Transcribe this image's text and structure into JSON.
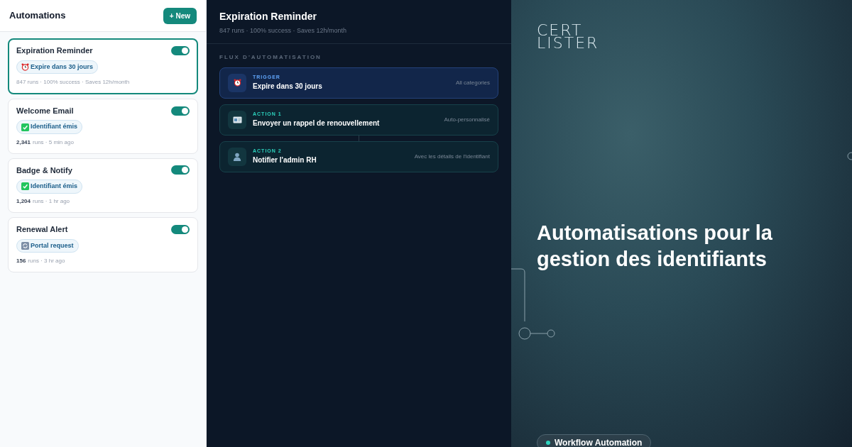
{
  "sidebar": {
    "title": "Automations",
    "new_button": "+ New",
    "items": [
      {
        "name": "Expiration Reminder",
        "on": true,
        "selected": true,
        "badge": {
          "kind": "clock",
          "label": "Expire dans 30 jours"
        },
        "count": "847 runs · 100% success · Saves 12h/month"
      },
      {
        "name": "Welcome Email",
        "on": true,
        "selected": false,
        "badge": {
          "kind": "check",
          "label": "Identifiant émis"
        },
        "count": "2,341",
        "meta": "runs · 5 min ago"
      },
      {
        "name": "Badge & Notify",
        "on": true,
        "selected": false,
        "badge": {
          "kind": "check",
          "label": "Identifiant émis"
        },
        "count": "1,204",
        "meta": "runs · 1 hr ago"
      },
      {
        "name": "Renewal Alert",
        "on": true,
        "selected": false,
        "badge": {
          "kind": "sync",
          "label": "Portal request"
        },
        "count": "156",
        "meta": "runs · 3 hr ago"
      }
    ]
  },
  "detail": {
    "title": "Expiration Reminder",
    "subtitle": "847 runs · 100% success · Saves 12h/month",
    "section": "FLUX D'AUTOMATISATION",
    "steps": [
      {
        "kind": "trigger",
        "label": "TRIGGER",
        "title": "Expire dans 30 jours",
        "note": "All categories"
      },
      {
        "kind": "action",
        "label": "ACTION 1",
        "title": "Envoyer un rappel de renouvellement",
        "note": "Auto-personnalisé"
      },
      {
        "kind": "action",
        "label": "ACTION 2",
        "title": "Notifier l'admin RH",
        "note": "Avec les détails de l'identifiant"
      }
    ]
  },
  "promo": {
    "logo": [
      "CERT",
      "LISTER"
    ],
    "headline": "Automatisations pour la gestion des identifiants",
    "pill": "Workflow Automation"
  }
}
